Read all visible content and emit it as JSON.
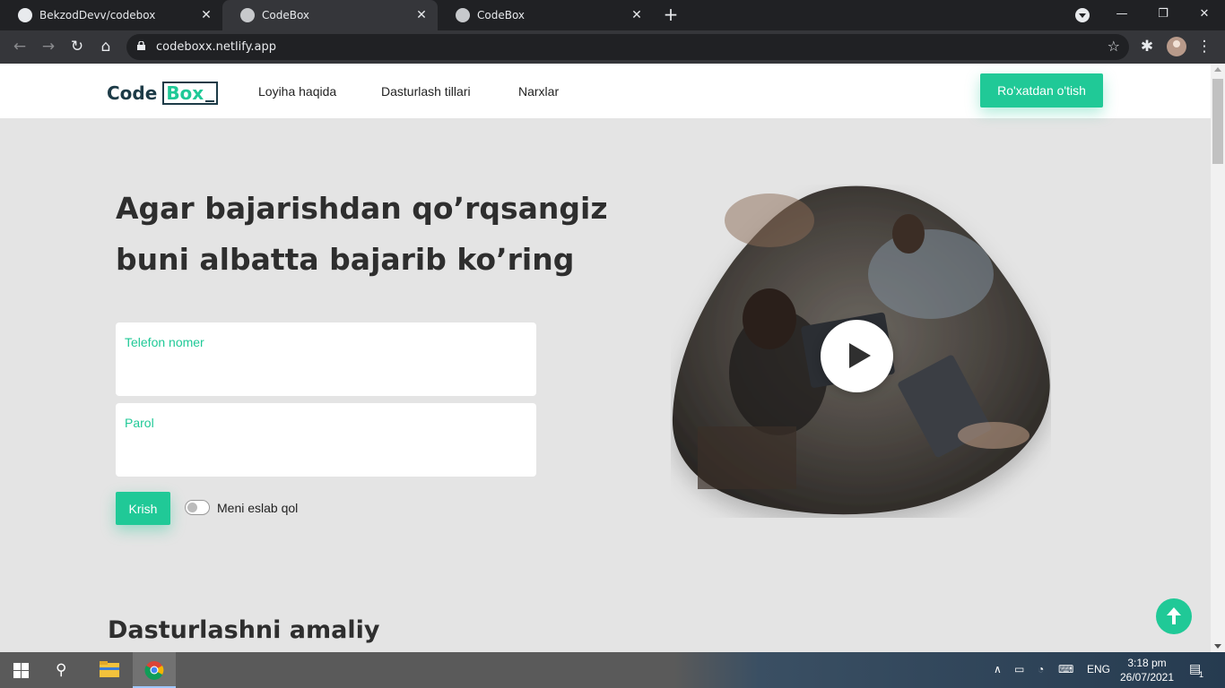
{
  "browser": {
    "tabs": [
      {
        "title": "BekzodDevv/codebox",
        "close": "✕"
      },
      {
        "title": "CodeBox",
        "close": "✕"
      },
      {
        "title": "CodeBox",
        "close": "✕"
      }
    ],
    "new_tab": "+",
    "url": "codeboxx.netlify.app",
    "window_controls": {
      "minimize": "—",
      "restore": "❐",
      "close": "✕"
    }
  },
  "header": {
    "logo_code": "Code",
    "logo_box": "Box",
    "nav": [
      "Loyiha haqida",
      "Dasturlash tillari",
      "Narxlar"
    ],
    "register_button": "Ro'xatdan o'tish"
  },
  "hero": {
    "title_line1": "Agar bajarishdan qo’rqsangiz",
    "title_line2": "buni albatta bajarib ko’ring",
    "phone_label": "Telefon nomer",
    "password_label": "Parol",
    "login_button": "Krish",
    "remember_label": "Meni eslab qol"
  },
  "section": {
    "title": "Dasturlashni amaliy"
  },
  "taskbar": {
    "language": "ENG",
    "time": "3:18 pm",
    "date": "26/07/2021",
    "notifications": "1"
  },
  "colors": {
    "accent": "#20c997",
    "page_bg": "#e4e4e4",
    "logo_dark": "#1d3b47"
  }
}
